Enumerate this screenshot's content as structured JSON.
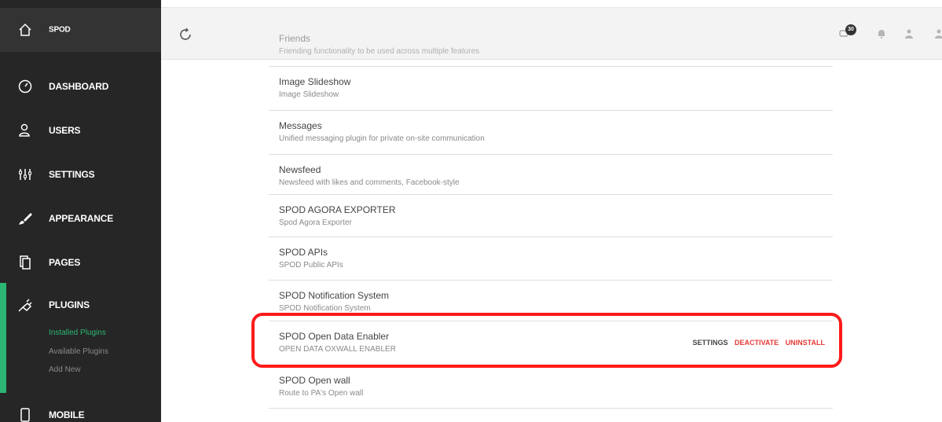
{
  "sidebar": {
    "brand": "SPOD",
    "items": [
      {
        "label": "DASHBOARD"
      },
      {
        "label": "USERS"
      },
      {
        "label": "SETTINGS"
      },
      {
        "label": "APPEARANCE"
      },
      {
        "label": "PAGES"
      },
      {
        "label": "PLUGINS"
      },
      {
        "label": "MOBILE"
      }
    ],
    "plugins_submenu": [
      "Installed Plugins",
      "Available Plugins",
      "Add New"
    ]
  },
  "header": {
    "notification_count": "30",
    "icons": [
      "chat-icon",
      "bell-icon",
      "user-icon",
      "user-icon"
    ]
  },
  "plugins": [
    {
      "title": "Friends",
      "desc": "Friending functionality to be used across multiple features"
    },
    {
      "title": "Image Slideshow",
      "desc": "Image Slideshow"
    },
    {
      "title": "Messages",
      "desc": "Unified messaging plugin for private on-site communication"
    },
    {
      "title": "Newsfeed",
      "desc": "Newsfeed with likes and comments, Facebook-style"
    },
    {
      "title": "SPOD AGORA EXPORTER",
      "desc": "Spod Agora Exporter"
    },
    {
      "title": "SPOD APIs",
      "desc": "SPOD Public APIs"
    },
    {
      "title": "SPOD Notification System",
      "desc": "SPOD Notification System"
    },
    {
      "title": "SPOD Open Data Enabler",
      "desc": "OPEN DATA OXWALL ENABLER"
    },
    {
      "title": "SPOD Open wall",
      "desc": "Route to PA's Open wall"
    }
  ],
  "highlighted_actions": {
    "settings": "SETTINGS",
    "deactivate": "DEACTIVATE",
    "uninstall": "UNINSTALL"
  },
  "colors": {
    "sidebar_bg": "#262626",
    "accent_green": "#2bb673",
    "highlight_red": "#ff1a1a",
    "action_red": "#e53935"
  }
}
